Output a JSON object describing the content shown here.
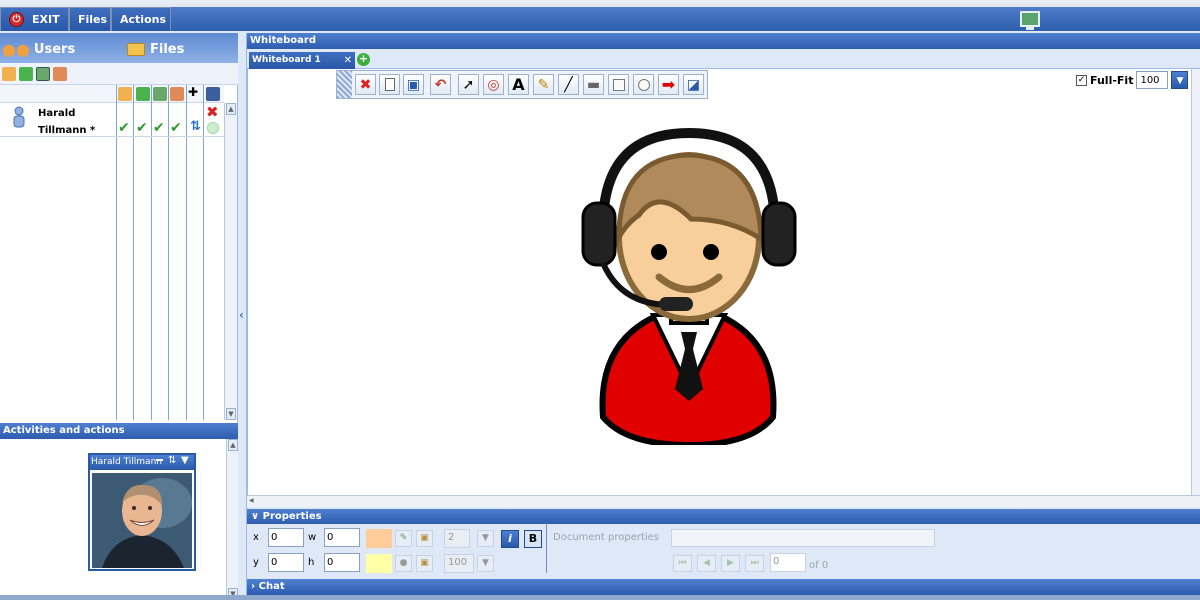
{
  "menu": {
    "exit_label": "EXIT",
    "files_label": "Files",
    "actions_label": "Actions"
  },
  "left_panel": {
    "tabs": {
      "users_label": "Users",
      "files_label": "Files"
    },
    "users": [
      {
        "name_first": "Harald",
        "name_last": "Tillmann *",
        "permissions": [
          "check",
          "check",
          "check",
          "check"
        ]
      }
    ],
    "activities_title": "Activities and actions",
    "video": {
      "title": "Harald Tillmann"
    }
  },
  "whiteboard": {
    "header": "Whiteboard",
    "tab_label": "Whiteboard 1",
    "tab_close": "✕",
    "add_tab": "+",
    "fullfit_label": "Full-Fit",
    "zoom_value": "100",
    "tools": [
      "clear-icon",
      "new-page-icon",
      "save-icon",
      "undo-icon",
      "pointer-icon",
      "zoom-icon",
      "text-icon",
      "pencil-icon",
      "line-icon",
      "underline-icon",
      "rectangle-icon",
      "ellipse-icon",
      "arrow-icon",
      "more-icon"
    ],
    "clipart": "call-center-agent-with-headset"
  },
  "properties": {
    "title": "Properties",
    "x_label": "x",
    "x_value": "0",
    "y_label": "y",
    "y_value": "0",
    "w_label": "w",
    "w_value": "0",
    "h_label": "h",
    "h_value": "0",
    "line_width": "2",
    "opacity": "100",
    "italic_label": "i",
    "bold_label": "B",
    "doc_props_label": "Document properties",
    "page_value": "0",
    "page_of": "of 0",
    "fill_color": "#ffcc99",
    "line_color": "#ffffa8"
  },
  "chat": {
    "title": "Chat"
  },
  "colors": {
    "accent": "#2e5db0",
    "panel_bg": "#dfe8f6",
    "shirt": "#e00000",
    "hair": "#b08a5a",
    "skin": "#f8cf9a"
  }
}
